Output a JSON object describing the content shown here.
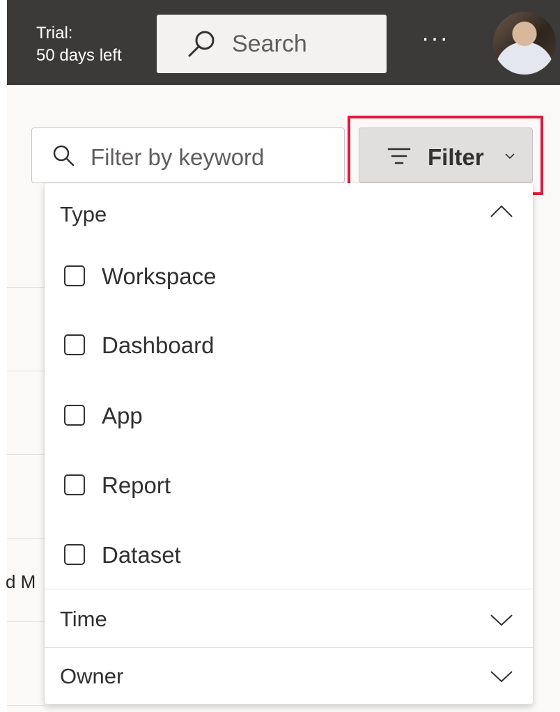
{
  "header": {
    "trial_line1": "Trial:",
    "trial_line2": "50 days left",
    "search_label": "Search",
    "more_label": "···",
    "search_icon": "search-icon",
    "avatar_icon": "user-avatar"
  },
  "background": {
    "partial_row_text": "d M"
  },
  "toolbar": {
    "keyword_placeholder": "Filter by keyword",
    "filter_label": "Filter",
    "highlight_color": "#e0193a"
  },
  "filter_panel": {
    "type_section": {
      "label": "Type",
      "expanded": true,
      "options": [
        {
          "label": "Workspace",
          "checked": false
        },
        {
          "label": "Dashboard",
          "checked": false
        },
        {
          "label": "App",
          "checked": false
        },
        {
          "label": "Report",
          "checked": false
        },
        {
          "label": "Dataset",
          "checked": false
        }
      ]
    },
    "time_section": {
      "label": "Time",
      "expanded": false
    },
    "owner_section": {
      "label": "Owner",
      "expanded": false
    }
  }
}
